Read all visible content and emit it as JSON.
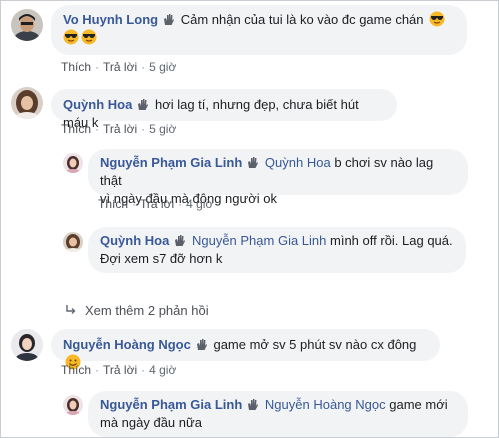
{
  "comments": [
    {
      "name": "Vo Huynh Long",
      "text": "Cảm nhận của tui là ko vào đc game chán",
      "like": "Thích",
      "reply": "Trả lời",
      "time": "5 giờ"
    },
    {
      "name": "Quỳnh Hoa",
      "text": "hơi lag tí, nhưng đẹp, chưa biết hút máu k",
      "like": "Thích",
      "reply": "Trả lời",
      "time": "5 giờ"
    },
    {
      "name": "Nguyễn Phạm Gia Linh",
      "tag": "Quỳnh Hoa",
      "text_line1": "b chơi sv nào lag thật",
      "text_line2": "vì ngày đầu mà đông người ok",
      "like": "Thích",
      "reply": "Trả lời",
      "time": "4 giờ"
    },
    {
      "name": "Quỳnh Hoa",
      "tag": "Nguyễn Phạm Gia Linh",
      "text_line1": "mình off rồi. Lag quá.",
      "text_line2": "Đợi xem s7 đỡ hơn k"
    },
    {
      "name": "Nguyễn Hoàng Ngọc",
      "text": "game mở sv 5 phút sv nào cx đông",
      "like": "Thích",
      "reply": "Trả lời",
      "time": "4 giờ"
    },
    {
      "name": "Nguyễn Phạm Gia Linh",
      "tag": "Nguyễn Hoàng Ngọc",
      "text_line1": "game mới",
      "text_line2": "mà ngày đầu nữa"
    }
  ],
  "view_more": "Xem thêm 2 phản hồi",
  "colors": {
    "name": "#385898",
    "bubble": "#f2f3f5",
    "meta": "#606770"
  }
}
